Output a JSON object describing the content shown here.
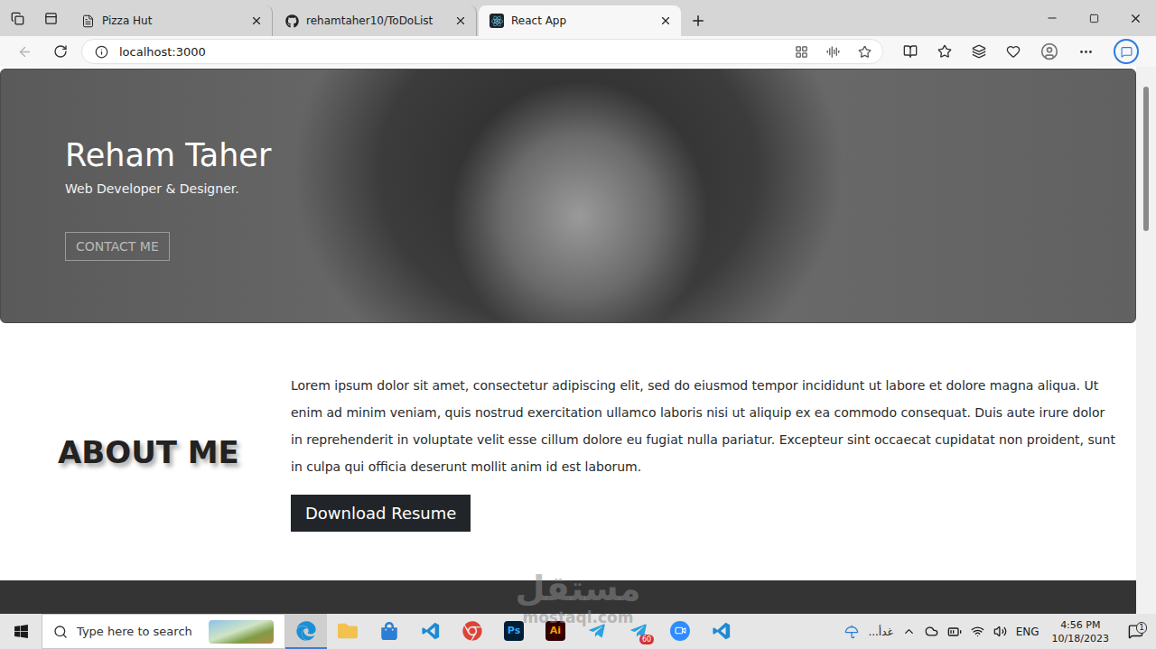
{
  "browser": {
    "tabs": [
      {
        "label": "Pizza Hut",
        "icon": "page",
        "selected": false
      },
      {
        "label": "rehamtaher10/ToDoList",
        "icon": "github",
        "selected": false
      },
      {
        "label": "React App",
        "icon": "react",
        "selected": true
      }
    ],
    "address": "localhost:3000"
  },
  "hero": {
    "name": "Reham Taher",
    "tagline": "Web Developer & Designer.",
    "button": "CONTACT ME"
  },
  "about": {
    "heading": "ABOUT ME",
    "text": "Lorem ipsum dolor sit amet, consectetur adipiscing elit, sed do eiusmod tempor incididunt ut labore et dolore magna aliqua. Ut enim ad minim veniam, quis nostrud exercitation ullamco laboris nisi ut aliquip ex ea commodo consequat. Duis aute irure dolor in reprehenderit in voluptate velit esse cillum dolore eu fugiat nulla pariatur. Excepteur sint occaecat cupidatat non proident, sunt in culpa qui officia deserunt mollit anim id est laborum.",
    "button": "Download Resume"
  },
  "taskbar": {
    "search_placeholder": "Type here to search",
    "apps": [
      {
        "kind": "edge",
        "selected": true
      },
      {
        "kind": "files",
        "selected": false
      },
      {
        "kind": "store",
        "selected": false
      },
      {
        "kind": "vscode",
        "selected": false
      },
      {
        "kind": "chrome",
        "selected": false
      },
      {
        "kind": "photoshop",
        "label": "Ps",
        "selected": false
      },
      {
        "kind": "illustrator",
        "label": "Ai",
        "selected": false
      },
      {
        "kind": "telegram",
        "selected": false
      },
      {
        "kind": "telegram",
        "badge": "60",
        "selected": false
      },
      {
        "kind": "zoom",
        "selected": false
      },
      {
        "kind": "vscode",
        "selected": false
      }
    ],
    "weather": "غدأ...",
    "language": "ENG",
    "time": "4:56 PM",
    "date": "10/18/2023",
    "notifications": "1"
  },
  "watermark": {
    "arabic": "مستقل",
    "latin": "mostaql.com"
  }
}
